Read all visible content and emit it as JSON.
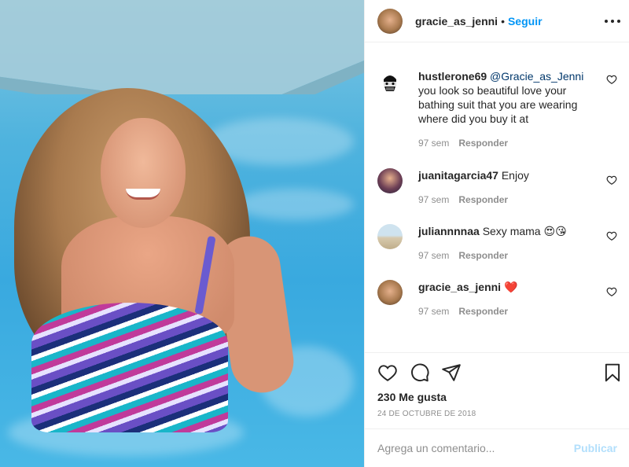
{
  "header": {
    "username": "gracie_as_jenni",
    "separator": "•",
    "follow_label": "Seguir",
    "more_icon": "more-horizontal-icon"
  },
  "comments": [
    {
      "username": "hustlerone69",
      "mention": "@Gracie_as_Jenni",
      "text": "you look so beautiful love your bathing suit that you are wearing where did you buy it at",
      "time": "97 sem",
      "reply_label": "Responder"
    },
    {
      "username": "juanitagarcia47",
      "text": "Enjoy",
      "time": "97 sem",
      "reply_label": "Responder"
    },
    {
      "username": "juliannnnaa",
      "text": "Sexy mama 😍😘",
      "time": "97 sem",
      "reply_label": "Responder"
    },
    {
      "username": "gracie_as_jenni",
      "text": "❤️",
      "time": "97 sem",
      "reply_label": "Responder"
    }
  ],
  "actions": {
    "like_icon": "heart-icon",
    "comment_icon": "comment-icon",
    "share_icon": "send-icon",
    "save_icon": "bookmark-icon"
  },
  "likes_text": "230 Me gusta",
  "date_text": "24 DE OCTUBRE DE 2018",
  "add_comment": {
    "placeholder": "Agrega un comentario...",
    "publish_label": "Publicar"
  },
  "colors": {
    "accent": "#0095f6",
    "publish_disabled": "#b2dffc",
    "muted": "#8e8e8e",
    "text": "#262626"
  }
}
